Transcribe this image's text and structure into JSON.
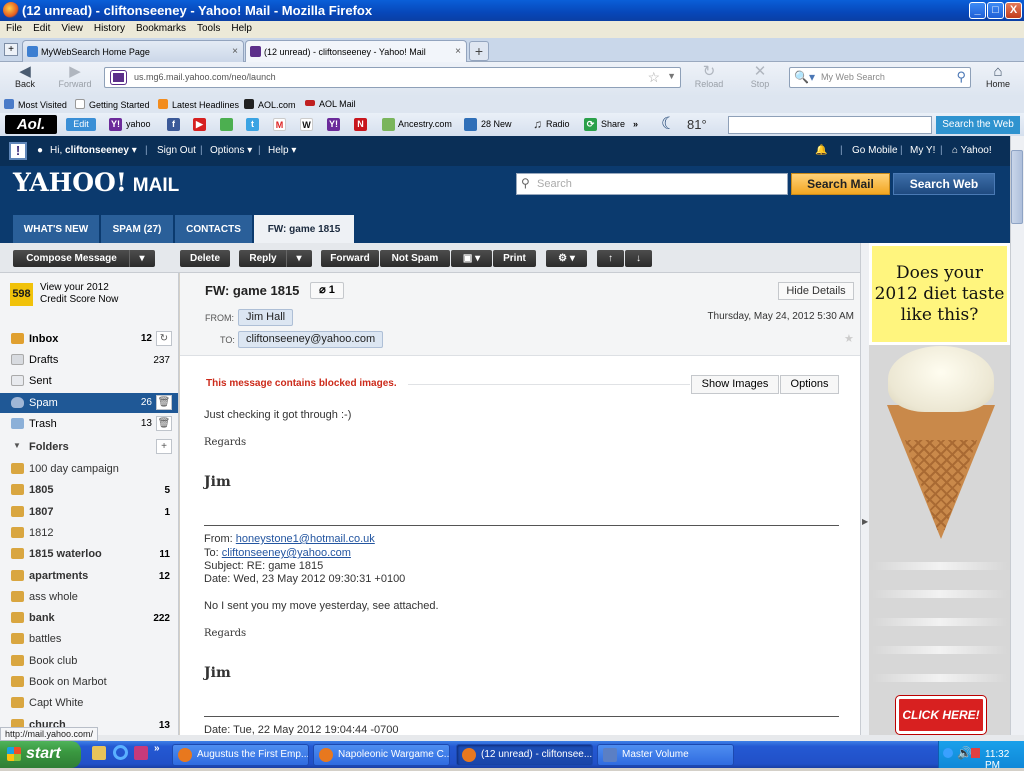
{
  "window": {
    "title": "(12 unread) - cliftonseeney - Yahoo! Mail - Mozilla Firefox",
    "min": "_",
    "max": "□",
    "close": "X"
  },
  "menu": [
    "File",
    "Edit",
    "View",
    "History",
    "Bookmarks",
    "Tools",
    "Help"
  ],
  "tabs": [
    {
      "label": "MyWebSearch Home Page",
      "close": "×"
    },
    {
      "label": "(12 unread) - cliftonseeney - Yahoo! Mail",
      "close": "×"
    }
  ],
  "new_tab": "+",
  "nav": {
    "back": "Back",
    "forward": "Forward",
    "reload": "Reload",
    "stop": "Stop",
    "home": "Home",
    "url": "us.mg6.mail.yahoo.com/neo/launch",
    "search_placeholder": "My Web Search"
  },
  "bookmarks": [
    "Most Visited",
    "Getting Started",
    "Latest Headlines",
    "AOL.com",
    "AOL Mail"
  ],
  "aol": {
    "logo": "Aol.",
    "edit": "Edit",
    "yahoo": "yahoo",
    "ancestry": "Ancestry.com",
    "news": "28 New",
    "radio": "Radio",
    "share": "Share",
    "more": "»",
    "temp": "81°",
    "search_btn": "Search the Web"
  },
  "yahoo": {
    "greeting": "Hi,",
    "user": "cliftonseeney",
    "sign_out": "Sign Out",
    "options": "Options",
    "help": "Help",
    "go_mobile": "Go Mobile",
    "my_y": "My Y!",
    "yahoo_link": "Yahoo!",
    "logo": "YAHOO!",
    "logo_mail": "MAIL",
    "search_placeholder": "Search",
    "search_mail": "Search Mail",
    "search_web": "Search Web",
    "tabs": [
      "WHAT'S NEW",
      "SPAM (27)",
      "CONTACTS",
      "FW: game 1815"
    ]
  },
  "toolbar": {
    "compose": "Compose Message",
    "delete": "Delete",
    "reply": "Reply",
    "forward": "Forward",
    "not_spam": "Not Spam",
    "print": "Print"
  },
  "credit": {
    "badge": "598",
    "line1": "View your 2012",
    "line2": "Credit Score Now"
  },
  "mailboxes": [
    {
      "name": "Inbox",
      "count": "12"
    },
    {
      "name": "Drafts",
      "count": "237"
    },
    {
      "name": "Sent",
      "count": ""
    },
    {
      "name": "Spam",
      "count": "26"
    },
    {
      "name": "Trash",
      "count": "13"
    }
  ],
  "folders_label": "Folders",
  "folders": [
    {
      "name": "100 day campaign",
      "count": ""
    },
    {
      "name": "1805",
      "count": "5"
    },
    {
      "name": "1807",
      "count": "1"
    },
    {
      "name": "1812",
      "count": ""
    },
    {
      "name": "1815 waterloo",
      "count": "11"
    },
    {
      "name": "apartments",
      "count": "12"
    },
    {
      "name": "ass whole",
      "count": ""
    },
    {
      "name": "bank",
      "count": "222"
    },
    {
      "name": "battles",
      "count": ""
    },
    {
      "name": "Book club",
      "count": ""
    },
    {
      "name": "Book on Marbot",
      "count": ""
    },
    {
      "name": "Capt White",
      "count": ""
    },
    {
      "name": "church",
      "count": "13"
    }
  ],
  "message": {
    "subject": "FW: game 1815",
    "attachments": "1",
    "hide_details": "Hide Details",
    "from_label": "FROM:",
    "from": "Jim Hall",
    "to_label": "TO:",
    "to": "cliftonseeney@yahoo.com",
    "date": "Thursday, May 24, 2012 5:30 AM",
    "blocked": "This message contains blocked images.",
    "show_images": "Show Images",
    "options": "Options",
    "body1": "Just checking it got through :-)",
    "regards": "Regards",
    "sig": "Jim",
    "fw_from_label": "From:",
    "fw_from": "honeystone1@hotmail.co.uk",
    "fw_to_label": "To:",
    "fw_to": "cliftonseeney@yahoo.com",
    "fw_subject": "Subject: RE: game 1815",
    "fw_date": "Date: Wed, 23 May 2012 09:30:31 +0100",
    "body2": "No I sent you my move yesterday, see attached.",
    "fw_date2": "Date: Tue, 22 May 2012 19:04:44 -0700"
  },
  "ad": {
    "headline": "Does your 2012 diet taste like this?",
    "cta": "CLICK HERE!"
  },
  "status_tip": "http://mail.yahoo.com/",
  "taskbar": {
    "start": "start",
    "tasks": [
      "Augustus the First Emp...",
      "Napoleonic Wargame C...",
      "(12 unread) - cliftonsee...",
      "Master Volume"
    ],
    "clock": "11:32 PM"
  }
}
